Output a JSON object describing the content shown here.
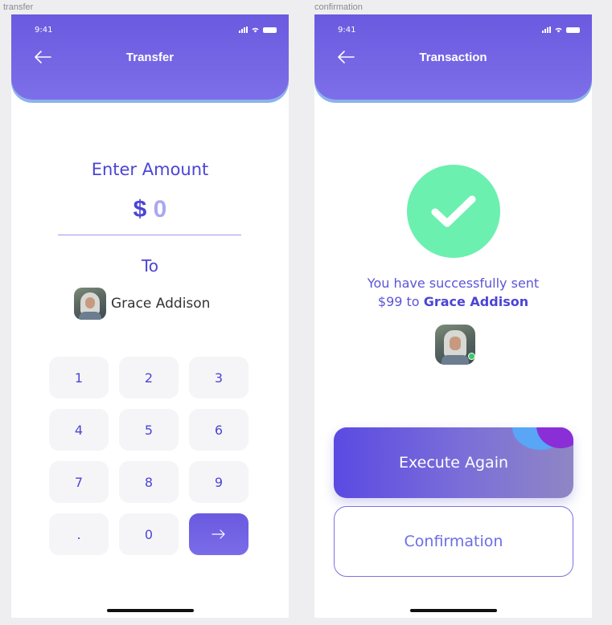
{
  "frames": [
    {
      "label": "transfer"
    },
    {
      "label": "confirmation"
    }
  ],
  "transfer": {
    "status_time": "9:41",
    "title": "Transfer",
    "enter_amount_label": "Enter Amount",
    "currency_symbol": "$",
    "amount_value": "0",
    "to_label": "To",
    "recipient_name": "Grace Addison",
    "keys": [
      "1",
      "2",
      "3",
      "4",
      "5",
      "6",
      "7",
      "8",
      "9",
      ".",
      "0",
      "→"
    ]
  },
  "transaction": {
    "status_time": "9:41",
    "title": "Transaction",
    "success_line1": "You have successfully sent",
    "success_amount": "$99 to",
    "success_recipient": "Grace Addison",
    "execute_again_label": "Execute Again",
    "confirmation_label": "Confirmation"
  },
  "colors": {
    "accent": "#6a5ae0",
    "success": "#6bf0b0",
    "online": "#38c96a"
  },
  "icons": {
    "back": "arrow-left-icon",
    "success": "check-icon",
    "next": "arrow-right-icon"
  }
}
